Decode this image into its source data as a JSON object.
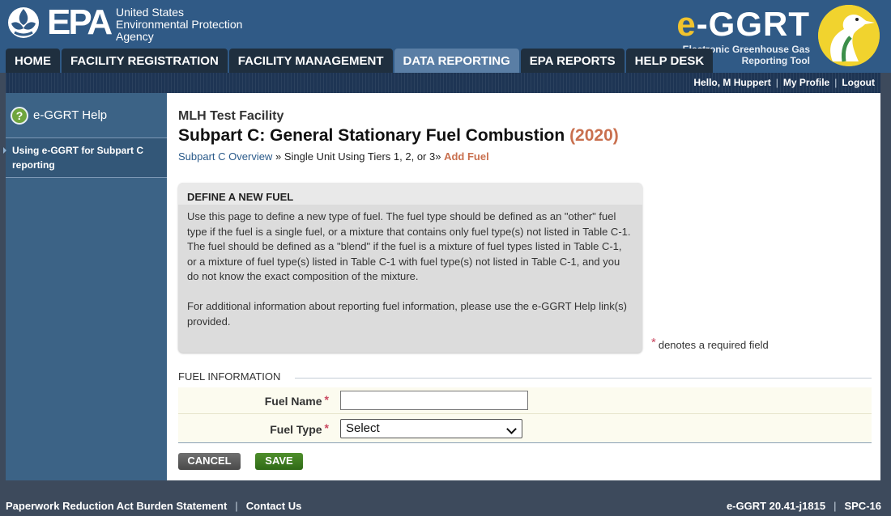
{
  "header": {
    "epa": {
      "wordmark": "EPA",
      "agency_lines": [
        "United States",
        "Environmental Protection",
        "Agency"
      ]
    },
    "brand": {
      "title_e": "e",
      "title_rest": "-GGRT",
      "subtitle_lines": [
        "Electronic Greenhouse Gas",
        "Reporting Tool"
      ]
    },
    "tabs": [
      {
        "label": "HOME",
        "active": false
      },
      {
        "label": "FACILITY REGISTRATION",
        "active": false
      },
      {
        "label": "FACILITY MANAGEMENT",
        "active": false
      },
      {
        "label": "DATA REPORTING",
        "active": true
      },
      {
        "label": "EPA REPORTS",
        "active": false
      },
      {
        "label": "HELP DESK",
        "active": false
      }
    ],
    "colors": {
      "header_bg": "#305a86",
      "tab_bg": "#1f2f3f",
      "tab_active_bg": "#5a7ea5",
      "accent": "#f1c32e"
    }
  },
  "userbar": {
    "greeting": "Hello, M Huppert",
    "sep": "|",
    "my_profile": "My Profile",
    "logout": "Logout"
  },
  "sidebar": {
    "help_title": "e-GGRT Help",
    "help_icon": "question-circle-icon",
    "help_icon_glyph": "?",
    "links": [
      "Using e-GGRT for Subpart C reporting"
    ]
  },
  "main": {
    "facility": "MLH Test Facility",
    "title": "Subpart C: General Stationary Fuel Combustion",
    "year": "(2020)",
    "breadcrumb": {
      "link": "Subpart C Overview",
      "sep": "»",
      "middle": "Single Unit Using Tiers 1, 2, or 3",
      "current": "Add Fuel"
    },
    "infobox": {
      "heading": "DEFINE A NEW FUEL",
      "para1": "Use this page to define a new type of fuel. The fuel type should be defined as an \"other\" fuel type if the fuel is a single fuel, or a mixture that contains only fuel type(s) not listed in Table C-1. The fuel should be defined as a \"blend\" if the fuel is a mixture of fuel types listed in Table C-1, or a mixture of fuel type(s) listed in Table C-1 with fuel type(s) not listed in Table C-1, and you do not know the exact composition of the mixture.",
      "para2": "For additional information about reporting fuel information, please use the e-GGRT Help link(s) provided."
    },
    "required_note": {
      "star": "*",
      "text": "denotes a required field"
    },
    "form": {
      "legend": "FUEL INFORMATION",
      "fuel_name": {
        "label": "Fuel Name",
        "star": "*",
        "value": ""
      },
      "fuel_type": {
        "label": "Fuel Type",
        "star": "*",
        "selected": "Select"
      }
    },
    "buttons": {
      "cancel": "CANCEL",
      "save": "SAVE"
    }
  },
  "footer": {
    "left": [
      "Paperwork Reduction Act Burden Statement",
      "Contact Us"
    ],
    "right": [
      "e-GGRT 20.41-j1815",
      "SPC-16"
    ],
    "sep": "|"
  }
}
